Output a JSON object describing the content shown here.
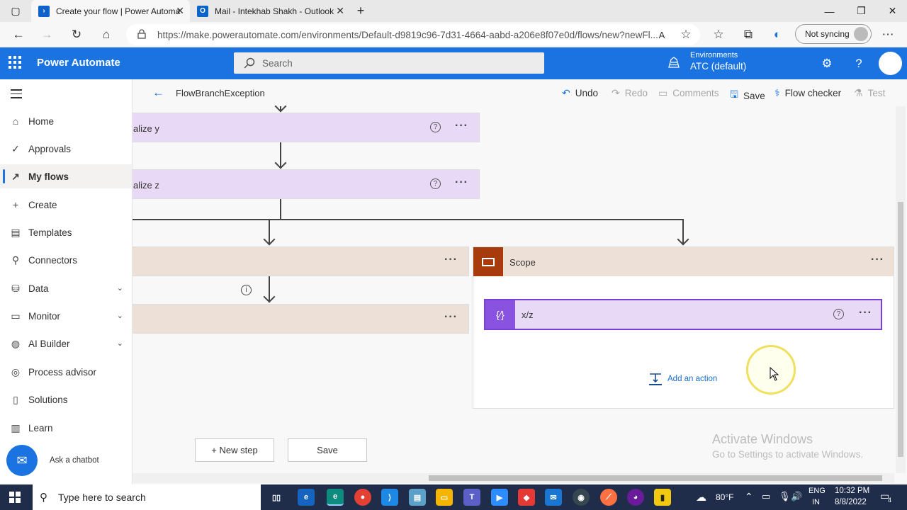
{
  "browser": {
    "tabs": [
      {
        "title": "Create your flow | Power Automa",
        "active": true
      },
      {
        "title": "Mail - Intekhab Shakh - Outlook",
        "active": false
      }
    ],
    "url": "https://make.powerautomate.com/environments/Default-d9819c96-7d31-4664-aabd-a206e8f07e0d/flows/new?newFl...",
    "sync_label": "Not syncing"
  },
  "header": {
    "brand": "Power Automate",
    "search_placeholder": "Search",
    "env_label": "Environments",
    "env_value": "ATC (default)",
    "color": "#1a73e0"
  },
  "nav": {
    "items": [
      {
        "label": "Home",
        "icon": "home-icon"
      },
      {
        "label": "Approvals",
        "icon": "approvals-icon"
      },
      {
        "label": "My flows",
        "icon": "flows-icon",
        "selected": true
      },
      {
        "label": "Create",
        "icon": "plus-icon"
      },
      {
        "label": "Templates",
        "icon": "templates-icon"
      },
      {
        "label": "Connectors",
        "icon": "connectors-icon"
      },
      {
        "label": "Data",
        "icon": "data-icon",
        "expandable": true
      },
      {
        "label": "Monitor",
        "icon": "monitor-icon",
        "expandable": true
      },
      {
        "label": "AI Builder",
        "icon": "ai-builder-icon",
        "expandable": true
      },
      {
        "label": "Process advisor",
        "icon": "process-advisor-icon"
      },
      {
        "label": "Solutions",
        "icon": "solutions-icon"
      },
      {
        "label": "Learn",
        "icon": "learn-icon"
      }
    ],
    "chatbot_label": "Ask a chatbot"
  },
  "command_bar": {
    "flow_name": "FlowBranchException",
    "undo": "Undo",
    "redo": "Redo",
    "comments": "Comments",
    "save": "Save",
    "flow_checker": "Flow checker",
    "test": "Test"
  },
  "canvas": {
    "card_y_title": "alize y",
    "card_z_title": "alize z",
    "scope_title": "Scope",
    "xz_title": "x/z",
    "add_action": "Add an action",
    "new_step": "+ New step",
    "save": "Save",
    "watermark_title": "Activate Windows",
    "watermark_sub": "Go to Settings to activate Windows."
  },
  "taskbar": {
    "search_placeholder": "Type here to search",
    "weather": "80°F",
    "lang": "ENG",
    "region": "IN",
    "time": "10:32 PM",
    "date": "8/8/2022",
    "notifications": "4"
  }
}
